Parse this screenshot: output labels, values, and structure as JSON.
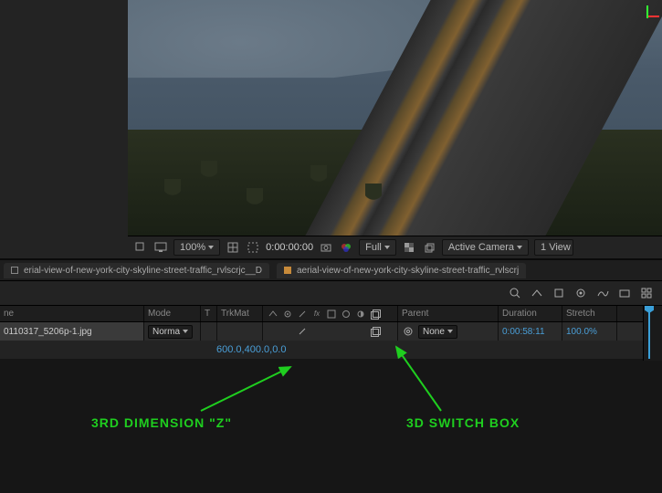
{
  "preview": {
    "zoom": "100%",
    "timecode": "0:00:00:00",
    "resolution": "Full",
    "view_camera": "Active Camera",
    "view_count": "1 View"
  },
  "tabs": [
    {
      "label": "erial-view-of-new-york-city-skyline-street-traffic_rvlscrjc__D",
      "active": true
    },
    {
      "label": "aerial-view-of-new-york-city-skyline-street-traffic_rvlscrj",
      "active": false
    }
  ],
  "columns": {
    "name": "ne",
    "mode": "Mode",
    "t": "T",
    "trkmat": "TrkMat",
    "parent": "Parent",
    "duration": "Duration",
    "stretch": "Stretch"
  },
  "layer": {
    "name": "0110317_5206p-1.jpg",
    "mode": "Norma",
    "parent": "None",
    "duration": "0:00:58:11",
    "stretch": "100.0%"
  },
  "position": {
    "x": "600.0",
    "y": "400.0",
    "z": "0.0"
  },
  "annotations": {
    "z_label": "3RD DIMENSION \"Z\"",
    "switch_label": "3D SWITCH BOX"
  },
  "icons": {
    "magnify": "magnify-icon",
    "grid": "grid-icon",
    "mask": "mask-icon",
    "region": "region-icon",
    "snapshot": "snapshot-icon",
    "channels": "channels-icon",
    "alpha": "alpha-icon",
    "view3d": "view3d-icon"
  }
}
